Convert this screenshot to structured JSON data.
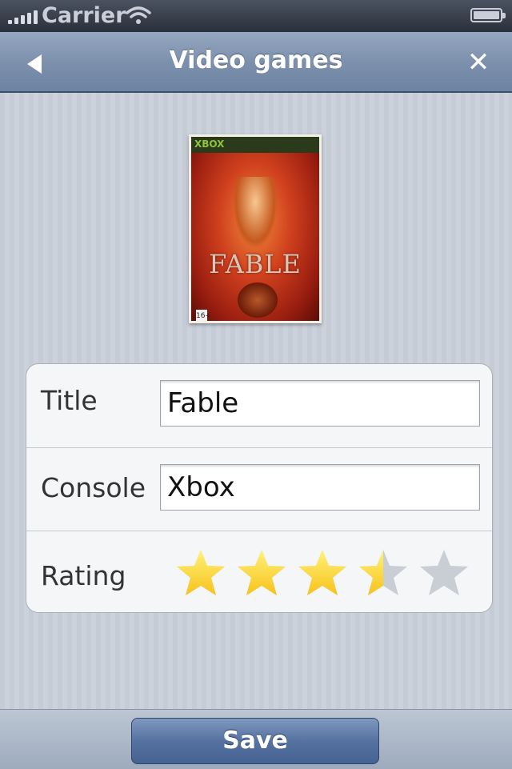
{
  "status_bar": {
    "carrier": "Carrier"
  },
  "nav": {
    "title": "Video games",
    "close_symbol": "✕"
  },
  "cover": {
    "image_alt": "Game cover art",
    "logo_text": "FABLE",
    "brand_text": "XBOX",
    "age_badge": "16+"
  },
  "form": {
    "title_label": "Title",
    "title_value": "Fable",
    "console_label": "Console",
    "console_value": "Xbox",
    "rating_label": "Rating",
    "rating_value": 3.5,
    "rating_max": 5
  },
  "colors": {
    "star_filled": "#f7c21a",
    "star_empty": "#c9cdd4"
  },
  "toolbar": {
    "save_label": "Save"
  }
}
